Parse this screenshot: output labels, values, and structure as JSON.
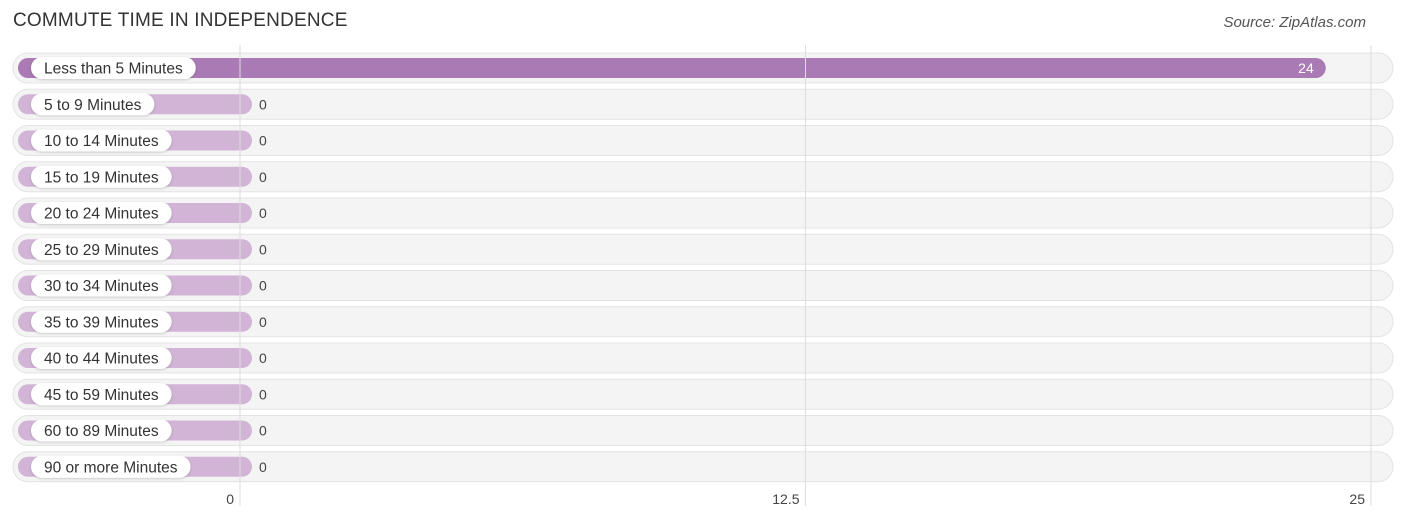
{
  "header": {
    "title": "COMMUTE TIME IN INDEPENDENCE",
    "source": "Source: ZipAtlas.com"
  },
  "colors": {
    "bar_highlight": "#a97ab3",
    "bar_default": "#d1b4d6",
    "track": "#f4f4f4",
    "grid": "#dddddd"
  },
  "chart_data": {
    "type": "bar",
    "orientation": "horizontal",
    "title": "COMMUTE TIME IN INDEPENDENCE",
    "xlabel": "",
    "ylabel": "",
    "categories": [
      "Less than 5 Minutes",
      "5 to 9 Minutes",
      "10 to 14 Minutes",
      "15 to 19 Minutes",
      "20 to 24 Minutes",
      "25 to 29 Minutes",
      "30 to 34 Minutes",
      "35 to 39 Minutes",
      "40 to 44 Minutes",
      "45 to 59 Minutes",
      "60 to 89 Minutes",
      "90 or more Minutes"
    ],
    "values": [
      24,
      0,
      0,
      0,
      0,
      0,
      0,
      0,
      0,
      0,
      0,
      0
    ],
    "value_labels": [
      "24",
      "0",
      "0",
      "0",
      "0",
      "0",
      "0",
      "0",
      "0",
      "0",
      "0",
      "0"
    ],
    "xlim": [
      0,
      25
    ],
    "xticks": [
      0,
      12.5,
      25
    ],
    "xtick_labels": [
      "0",
      "12.5",
      "25"
    ],
    "grid": true,
    "legend": "none"
  }
}
